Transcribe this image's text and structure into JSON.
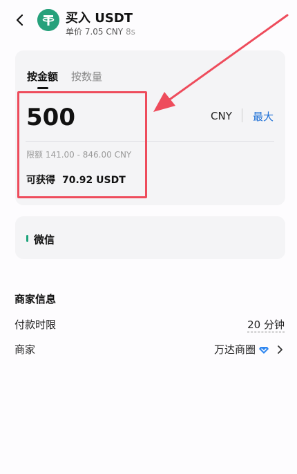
{
  "header": {
    "title": "买入 USDT",
    "unit_price": "单价 7.05 CNY",
    "timer": "8s",
    "coin_icon": "tether-icon"
  },
  "order": {
    "tabs": [
      "按金额",
      "按数量"
    ],
    "active_tab": "按金额",
    "amount": "500",
    "currency": "CNY",
    "max_label": "最大",
    "limit_text": "限额 141.00 - 846.00 CNY",
    "receive_label": "可获得",
    "receive_value": "70.92 USDT"
  },
  "payment": {
    "method": "微信",
    "accent_color": "#1ba37a"
  },
  "merchant_info": {
    "title": "商家信息",
    "payment_limit_label": "付款时限",
    "payment_limit_value": "20 分钟",
    "merchant_label": "商家",
    "merchant_name": "万达商圈"
  },
  "colors": {
    "highlight": "#ee4c5c",
    "link": "#1d6fd6",
    "tether": "#26a17b"
  }
}
